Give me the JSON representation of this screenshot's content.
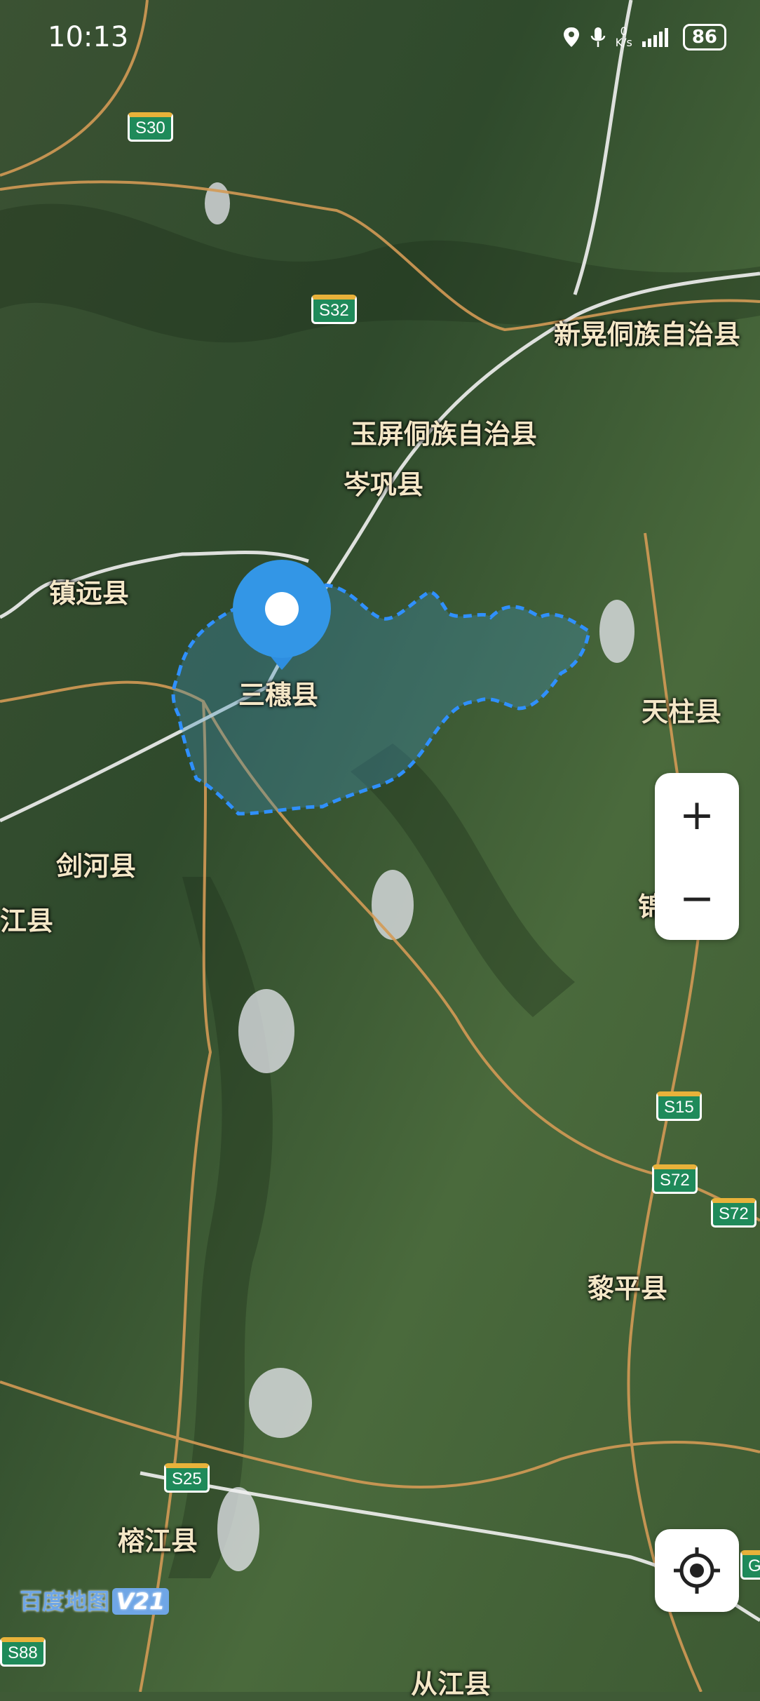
{
  "status_bar": {
    "time": "10:13",
    "net_speed_value": "0",
    "net_speed_unit": "K/s",
    "battery": "86"
  },
  "colors": {
    "region_fill": "#3f8fb8",
    "region_border": "#2f90ff",
    "pin": "#2e8ee0",
    "road": "#d39a55",
    "label": "#f3e6c6"
  },
  "places": [
    {
      "name": "新晃侗族自治县"
    },
    {
      "name": "玉屏侗族自治县"
    },
    {
      "name": "岑巩县"
    },
    {
      "name": "镇远县"
    },
    {
      "name": "三穗县"
    },
    {
      "name": "天柱县"
    },
    {
      "name": "剑河县"
    },
    {
      "name": "江县"
    },
    {
      "name": "锦"
    },
    {
      "name": "黎平县"
    },
    {
      "name": "榕江县"
    },
    {
      "name": "从江县"
    }
  ],
  "road_shields": [
    {
      "code": "S30"
    },
    {
      "code": "S32"
    },
    {
      "code": "S15"
    },
    {
      "code": "S72"
    },
    {
      "code": "S72"
    },
    {
      "code": "S25"
    },
    {
      "code": "S88"
    },
    {
      "code": "G"
    }
  ],
  "selected_region": {
    "name": "三穗县"
  },
  "controls": {
    "zoom_in": "+",
    "zoom_out": "−",
    "locate_icon": "target-icon"
  },
  "brand": {
    "name": "百度地图",
    "version": "V21"
  }
}
